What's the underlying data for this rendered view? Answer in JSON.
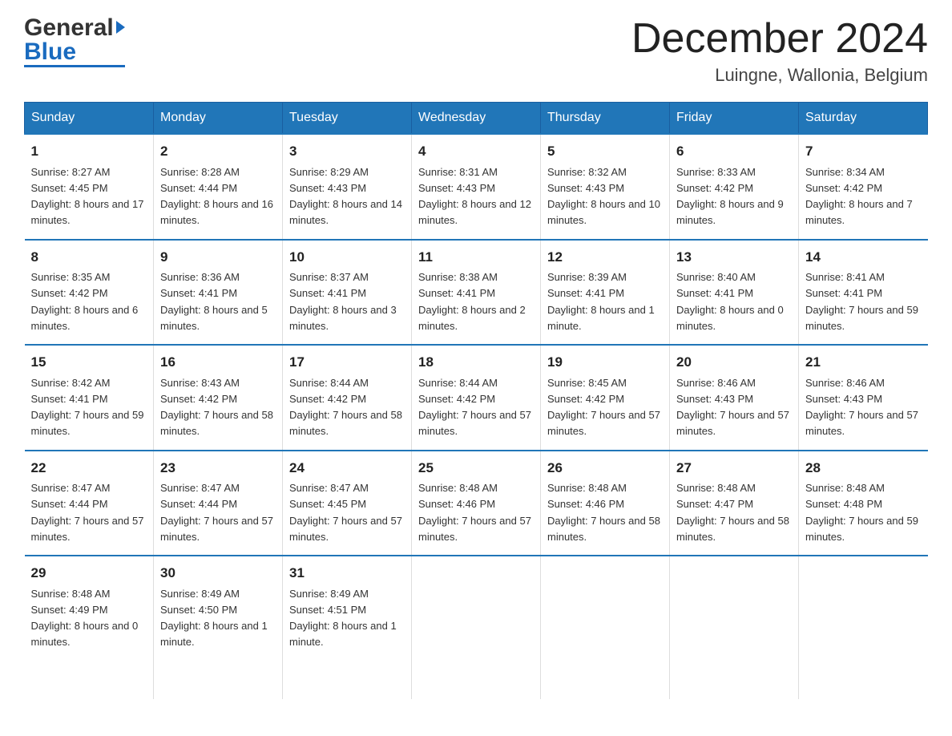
{
  "header": {
    "logo_general": "General",
    "logo_blue": "Blue",
    "month_title": "December 2024",
    "location": "Luingne, Wallonia, Belgium"
  },
  "days_of_week": [
    "Sunday",
    "Monday",
    "Tuesday",
    "Wednesday",
    "Thursday",
    "Friday",
    "Saturday"
  ],
  "weeks": [
    [
      {
        "day": "1",
        "sunrise": "8:27 AM",
        "sunset": "4:45 PM",
        "daylight": "8 hours and 17 minutes."
      },
      {
        "day": "2",
        "sunrise": "8:28 AM",
        "sunset": "4:44 PM",
        "daylight": "8 hours and 16 minutes."
      },
      {
        "day": "3",
        "sunrise": "8:29 AM",
        "sunset": "4:43 PM",
        "daylight": "8 hours and 14 minutes."
      },
      {
        "day": "4",
        "sunrise": "8:31 AM",
        "sunset": "4:43 PM",
        "daylight": "8 hours and 12 minutes."
      },
      {
        "day": "5",
        "sunrise": "8:32 AM",
        "sunset": "4:43 PM",
        "daylight": "8 hours and 10 minutes."
      },
      {
        "day": "6",
        "sunrise": "8:33 AM",
        "sunset": "4:42 PM",
        "daylight": "8 hours and 9 minutes."
      },
      {
        "day": "7",
        "sunrise": "8:34 AM",
        "sunset": "4:42 PM",
        "daylight": "8 hours and 7 minutes."
      }
    ],
    [
      {
        "day": "8",
        "sunrise": "8:35 AM",
        "sunset": "4:42 PM",
        "daylight": "8 hours and 6 minutes."
      },
      {
        "day": "9",
        "sunrise": "8:36 AM",
        "sunset": "4:41 PM",
        "daylight": "8 hours and 5 minutes."
      },
      {
        "day": "10",
        "sunrise": "8:37 AM",
        "sunset": "4:41 PM",
        "daylight": "8 hours and 3 minutes."
      },
      {
        "day": "11",
        "sunrise": "8:38 AM",
        "sunset": "4:41 PM",
        "daylight": "8 hours and 2 minutes."
      },
      {
        "day": "12",
        "sunrise": "8:39 AM",
        "sunset": "4:41 PM",
        "daylight": "8 hours and 1 minute."
      },
      {
        "day": "13",
        "sunrise": "8:40 AM",
        "sunset": "4:41 PM",
        "daylight": "8 hours and 0 minutes."
      },
      {
        "day": "14",
        "sunrise": "8:41 AM",
        "sunset": "4:41 PM",
        "daylight": "7 hours and 59 minutes."
      }
    ],
    [
      {
        "day": "15",
        "sunrise": "8:42 AM",
        "sunset": "4:41 PM",
        "daylight": "7 hours and 59 minutes."
      },
      {
        "day": "16",
        "sunrise": "8:43 AM",
        "sunset": "4:42 PM",
        "daylight": "7 hours and 58 minutes."
      },
      {
        "day": "17",
        "sunrise": "8:44 AM",
        "sunset": "4:42 PM",
        "daylight": "7 hours and 58 minutes."
      },
      {
        "day": "18",
        "sunrise": "8:44 AM",
        "sunset": "4:42 PM",
        "daylight": "7 hours and 57 minutes."
      },
      {
        "day": "19",
        "sunrise": "8:45 AM",
        "sunset": "4:42 PM",
        "daylight": "7 hours and 57 minutes."
      },
      {
        "day": "20",
        "sunrise": "8:46 AM",
        "sunset": "4:43 PM",
        "daylight": "7 hours and 57 minutes."
      },
      {
        "day": "21",
        "sunrise": "8:46 AM",
        "sunset": "4:43 PM",
        "daylight": "7 hours and 57 minutes."
      }
    ],
    [
      {
        "day": "22",
        "sunrise": "8:47 AM",
        "sunset": "4:44 PM",
        "daylight": "7 hours and 57 minutes."
      },
      {
        "day": "23",
        "sunrise": "8:47 AM",
        "sunset": "4:44 PM",
        "daylight": "7 hours and 57 minutes."
      },
      {
        "day": "24",
        "sunrise": "8:47 AM",
        "sunset": "4:45 PM",
        "daylight": "7 hours and 57 minutes."
      },
      {
        "day": "25",
        "sunrise": "8:48 AM",
        "sunset": "4:46 PM",
        "daylight": "7 hours and 57 minutes."
      },
      {
        "day": "26",
        "sunrise": "8:48 AM",
        "sunset": "4:46 PM",
        "daylight": "7 hours and 58 minutes."
      },
      {
        "day": "27",
        "sunrise": "8:48 AM",
        "sunset": "4:47 PM",
        "daylight": "7 hours and 58 minutes."
      },
      {
        "day": "28",
        "sunrise": "8:48 AM",
        "sunset": "4:48 PM",
        "daylight": "7 hours and 59 minutes."
      }
    ],
    [
      {
        "day": "29",
        "sunrise": "8:48 AM",
        "sunset": "4:49 PM",
        "daylight": "8 hours and 0 minutes."
      },
      {
        "day": "30",
        "sunrise": "8:49 AM",
        "sunset": "4:50 PM",
        "daylight": "8 hours and 1 minute."
      },
      {
        "day": "31",
        "sunrise": "8:49 AM",
        "sunset": "4:51 PM",
        "daylight": "8 hours and 1 minute."
      },
      null,
      null,
      null,
      null
    ]
  ],
  "labels": {
    "sunrise": "Sunrise:",
    "sunset": "Sunset:",
    "daylight": "Daylight:"
  }
}
